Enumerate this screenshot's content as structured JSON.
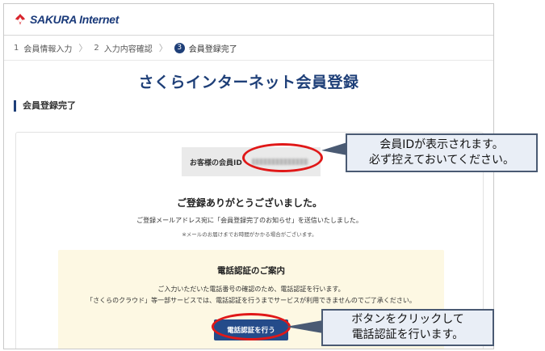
{
  "header": {
    "logo_text": "SAKURA Internet",
    "logo_icon": "sakura-flower-icon"
  },
  "steps": [
    {
      "num": "1",
      "label": "会員情報入力"
    },
    {
      "num": "2",
      "label": "入力内容確認"
    },
    {
      "num": "3",
      "label": "会員登録完了"
    }
  ],
  "page_title": "さくらインターネット会員登録",
  "section_heading": "会員登録完了",
  "id_box": {
    "label": "お客様の会員ID"
  },
  "thanks": "ご登録ありがとうございました。",
  "sent_message": "ご登録メールアドレス宛に「会員登録完了のお知らせ」を送信いたしました。",
  "note": "※メールのお届けまでお時間がかかる場合がございます。",
  "phone": {
    "title": "電話認証のご案内",
    "line1": "ご入力いただいた電話番号の確認のため、電話認証を行います。",
    "line2": "「さくらのクラウド」等一部サービスでは、電話認証を行うまでサービスが利用できませんのでご了承ください。",
    "button": "電話認証を行う"
  },
  "callouts": {
    "id": {
      "line1": "会員IDが表示されます。",
      "line2": "必ず控えておいてください。"
    },
    "button": {
      "line1": "ボタンをクリックして",
      "line2": "電話認証を行います。"
    }
  },
  "colors": {
    "brand": "#1e3f78",
    "highlight": "#e01818",
    "callout_bg": "#e9eef6"
  }
}
